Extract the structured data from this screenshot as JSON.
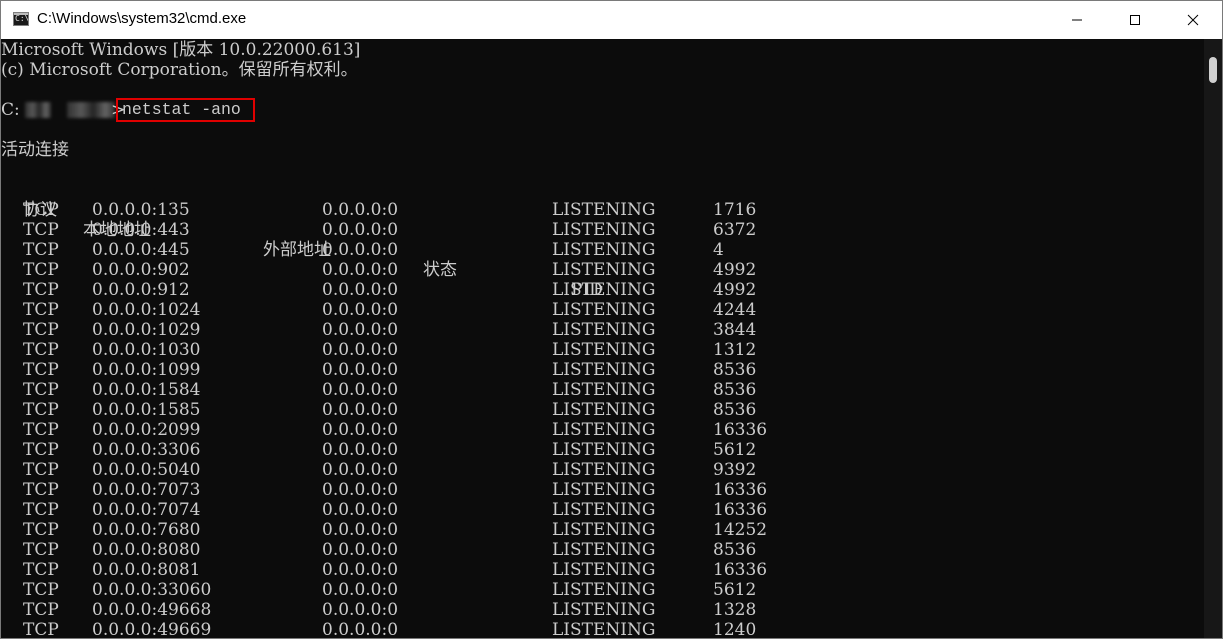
{
  "window": {
    "title": "C:\\Windows\\system32\\cmd.exe",
    "app_icon_text": "C:\\"
  },
  "console": {
    "banner": [
      "Microsoft Windows [版本 10.0.22000.613]",
      "(c) Microsoft Corporation。保留所有权利。"
    ],
    "prompt_prefix": "C:",
    "prompt_suffix": ">",
    "command": "netstat -ano",
    "section_title": "活动连接",
    "headers": {
      "proto": "协议",
      "local": "本地地址",
      "foreign": "外部地址",
      "state": "状态",
      "pid": "PID"
    },
    "rows": [
      {
        "proto": "TCP",
        "local": "0.0.0.0:135",
        "foreign": "0.0.0.0:0",
        "state": "LISTENING",
        "pid": "1716"
      },
      {
        "proto": "TCP",
        "local": "0.0.0.0:443",
        "foreign": "0.0.0.0:0",
        "state": "LISTENING",
        "pid": "6372"
      },
      {
        "proto": "TCP",
        "local": "0.0.0.0:445",
        "foreign": "0.0.0.0:0",
        "state": "LISTENING",
        "pid": "4"
      },
      {
        "proto": "TCP",
        "local": "0.0.0.0:902",
        "foreign": "0.0.0.0:0",
        "state": "LISTENING",
        "pid": "4992"
      },
      {
        "proto": "TCP",
        "local": "0.0.0.0:912",
        "foreign": "0.0.0.0:0",
        "state": "LISTENING",
        "pid": "4992"
      },
      {
        "proto": "TCP",
        "local": "0.0.0.0:1024",
        "foreign": "0.0.0.0:0",
        "state": "LISTENING",
        "pid": "4244"
      },
      {
        "proto": "TCP",
        "local": "0.0.0.0:1029",
        "foreign": "0.0.0.0:0",
        "state": "LISTENING",
        "pid": "3844"
      },
      {
        "proto": "TCP",
        "local": "0.0.0.0:1030",
        "foreign": "0.0.0.0:0",
        "state": "LISTENING",
        "pid": "1312"
      },
      {
        "proto": "TCP",
        "local": "0.0.0.0:1099",
        "foreign": "0.0.0.0:0",
        "state": "LISTENING",
        "pid": "8536"
      },
      {
        "proto": "TCP",
        "local": "0.0.0.0:1584",
        "foreign": "0.0.0.0:0",
        "state": "LISTENING",
        "pid": "8536"
      },
      {
        "proto": "TCP",
        "local": "0.0.0.0:1585",
        "foreign": "0.0.0.0:0",
        "state": "LISTENING",
        "pid": "8536"
      },
      {
        "proto": "TCP",
        "local": "0.0.0.0:2099",
        "foreign": "0.0.0.0:0",
        "state": "LISTENING",
        "pid": "16336"
      },
      {
        "proto": "TCP",
        "local": "0.0.0.0:3306",
        "foreign": "0.0.0.0:0",
        "state": "LISTENING",
        "pid": "5612"
      },
      {
        "proto": "TCP",
        "local": "0.0.0.0:5040",
        "foreign": "0.0.0.0:0",
        "state": "LISTENING",
        "pid": "9392"
      },
      {
        "proto": "TCP",
        "local": "0.0.0.0:7073",
        "foreign": "0.0.0.0:0",
        "state": "LISTENING",
        "pid": "16336"
      },
      {
        "proto": "TCP",
        "local": "0.0.0.0:7074",
        "foreign": "0.0.0.0:0",
        "state": "LISTENING",
        "pid": "16336"
      },
      {
        "proto": "TCP",
        "local": "0.0.0.0:7680",
        "foreign": "0.0.0.0:0",
        "state": "LISTENING",
        "pid": "14252"
      },
      {
        "proto": "TCP",
        "local": "0.0.0.0:8080",
        "foreign": "0.0.0.0:0",
        "state": "LISTENING",
        "pid": "8536"
      },
      {
        "proto": "TCP",
        "local": "0.0.0.0:8081",
        "foreign": "0.0.0.0:0",
        "state": "LISTENING",
        "pid": "16336"
      },
      {
        "proto": "TCP",
        "local": "0.0.0.0:33060",
        "foreign": "0.0.0.0:0",
        "state": "LISTENING",
        "pid": "5612"
      },
      {
        "proto": "TCP",
        "local": "0.0.0.0:49668",
        "foreign": "0.0.0.0:0",
        "state": "LISTENING",
        "pid": "1328"
      },
      {
        "proto": "TCP",
        "local": "0.0.0.0:49669",
        "foreign": "0.0.0.0:0",
        "state": "LISTENING",
        "pid": "1240"
      }
    ]
  },
  "colors": {
    "console_bg": "#0c0c0c",
    "console_text": "#cccccc",
    "highlight_border": "#e00000",
    "titlebar_bg": "#ffffff"
  },
  "icons": {
    "minimize": "minimize-icon",
    "maximize": "maximize-icon",
    "close": "close-icon"
  }
}
